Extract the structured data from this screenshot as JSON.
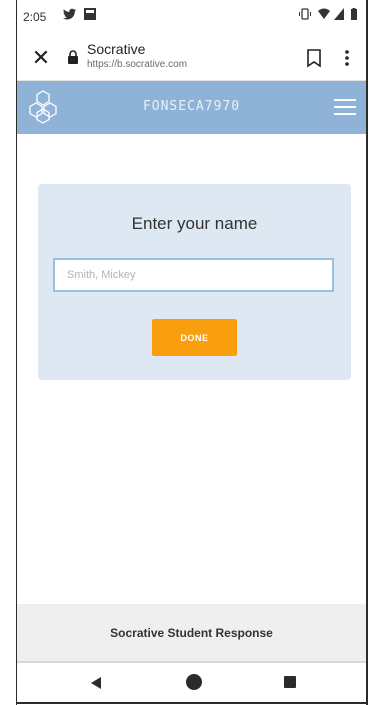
{
  "status_bar": {
    "time": "2:05",
    "left_icons": [
      "twitter-icon",
      "photo-icon"
    ],
    "right_icons": [
      "vibrate-icon",
      "wifi-icon",
      "signal-icon",
      "battery-icon"
    ]
  },
  "browser": {
    "title": "Socrative",
    "url": "https://b.socrative.com",
    "close_icon": "close-icon",
    "lock_icon": "lock-icon",
    "bookmark_icon": "bookmark-icon",
    "menu_icon": "more-vert-icon"
  },
  "app_header": {
    "room_name": "FONSECA7970",
    "logo_icon": "hexagon-logo-icon",
    "menu_icon": "hamburger-icon",
    "color": "#8eb3d6"
  },
  "name_card": {
    "title": "Enter your name",
    "input_placeholder": "Smith, Mickey",
    "input_value": "",
    "button_label": "DONE",
    "button_color": "#f99e0c",
    "card_color": "#dde8f2"
  },
  "footer": {
    "text": "Socrative Student Response"
  },
  "nav_bar": {
    "icons": [
      "back-icon",
      "home-icon",
      "recents-icon"
    ]
  }
}
